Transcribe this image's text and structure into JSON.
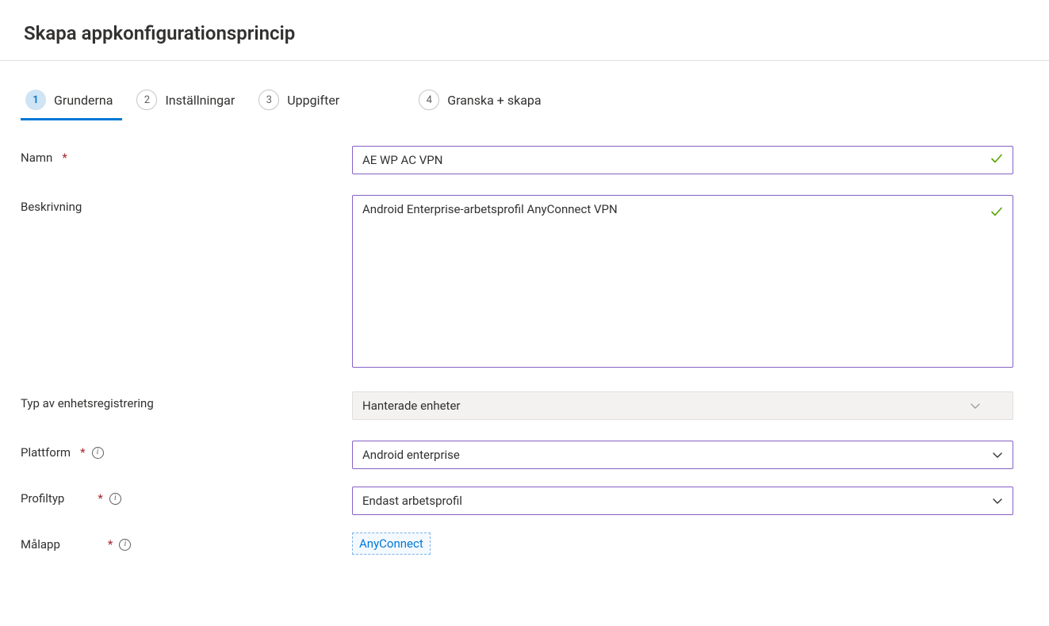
{
  "header": {
    "title": "Skapa appkonfigurationsprincip"
  },
  "tabs": [
    {
      "num": "1",
      "label": "Grunderna",
      "active": true
    },
    {
      "num": "2",
      "label": "Inställningar",
      "active": false
    },
    {
      "num": "3",
      "label": "Uppgifter",
      "active": false
    },
    {
      "num": "4",
      "label": "Granska + skapa",
      "active": false
    }
  ],
  "form": {
    "name": {
      "label": "Namn",
      "value": "AE WP AC VPN"
    },
    "description": {
      "label": "Beskrivning",
      "value": "Android Enterprise-arbetsprofil AnyConnect VPN"
    },
    "enrollment_type": {
      "label": "Typ av enhetsregistrering",
      "value": "Hanterade enheter"
    },
    "platform": {
      "label": "Plattform",
      "value": "Android enterprise"
    },
    "profile_type": {
      "label": "Profiltyp",
      "value": "Endast arbetsprofil"
    },
    "target_app": {
      "label": "Målapp",
      "value": "AnyConnect"
    }
  }
}
